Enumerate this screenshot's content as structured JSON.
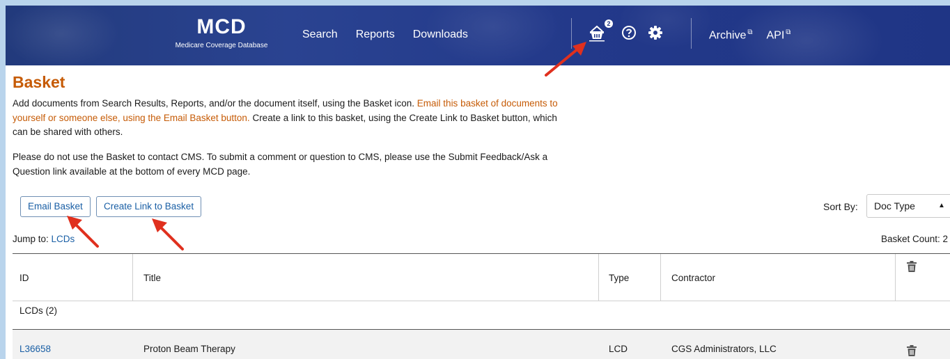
{
  "header": {
    "logo_main": "MCD",
    "logo_sub": "Medicare Coverage Database",
    "nav": [
      "Search",
      "Reports",
      "Downloads"
    ],
    "basket_count_badge": "2",
    "external_links": [
      "Archive",
      "API"
    ]
  },
  "page": {
    "title": "Basket",
    "intro_part1": "Add documents from Search Results, Reports, and/or the document itself, using the Basket icon. ",
    "intro_highlight": "Email this basket of documents to yourself or someone else, using the Email Basket button.",
    "intro_part2": " Create a link to this basket, using the Create Link to Basket button, which can be shared with others.",
    "notice": "Please do not use the Basket to contact CMS. To submit a comment or question to CMS, please use the Submit Feedback/Ask a Question link available at the bottom of every MCD page."
  },
  "actions": {
    "email_basket": "Email Basket",
    "create_link": "Create Link to Basket",
    "sort_label": "Sort By:",
    "sort_value": "Doc Type"
  },
  "jump": {
    "label": "Jump to: ",
    "link": "LCDs"
  },
  "basket_count": "Basket Count: 2",
  "table": {
    "headers": {
      "id": "ID",
      "title": "Title",
      "type": "Type",
      "contractor": "Contractor"
    },
    "group": "LCDs (2)",
    "rows": [
      {
        "id": "L36658",
        "title": "Proton Beam Therapy",
        "type": "LCD",
        "contractor": "CGS Administrators, LLC"
      }
    ]
  },
  "colors": {
    "brand_navy": "#23398a",
    "accent_orange": "#c65b06",
    "link_blue": "#1a5fa5",
    "annotation_red": "#e0301e"
  }
}
